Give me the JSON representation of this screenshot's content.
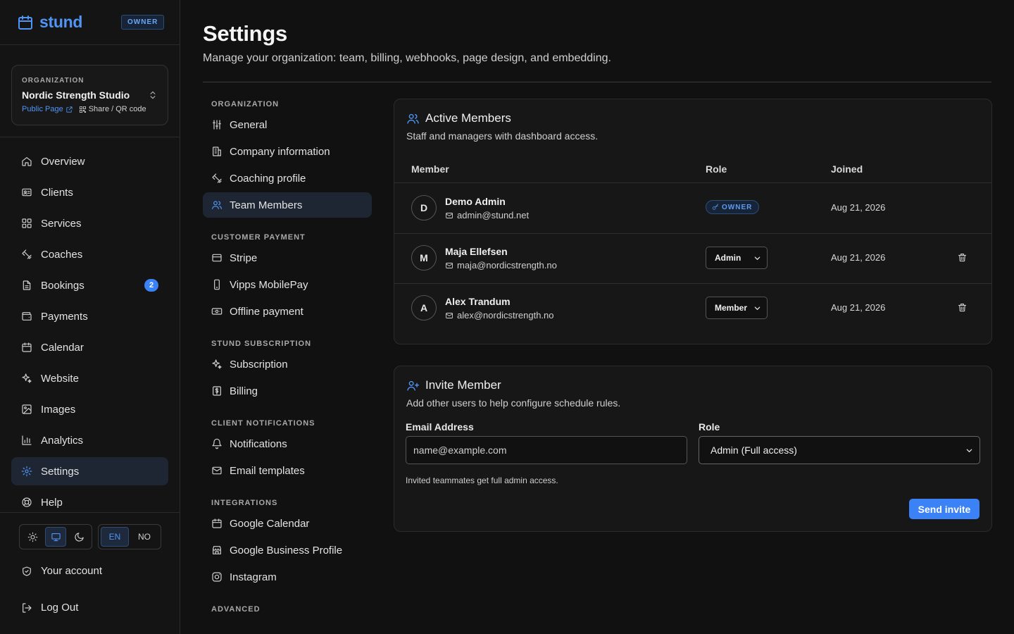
{
  "brand": {
    "name": "stund",
    "role_badge": "OWNER"
  },
  "org": {
    "label": "ORGANIZATION",
    "name": "Nordic Strength Studio",
    "public_page": "Public Page",
    "share": "Share / QR code"
  },
  "nav": {
    "items": [
      {
        "label": "Overview",
        "icon": "home-icon"
      },
      {
        "label": "Clients",
        "icon": "id-card-icon"
      },
      {
        "label": "Services",
        "icon": "grid-icon"
      },
      {
        "label": "Coaches",
        "icon": "dumbbell-icon"
      },
      {
        "label": "Bookings",
        "icon": "document-icon",
        "count": "2"
      },
      {
        "label": "Payments",
        "icon": "wallet-icon"
      },
      {
        "label": "Calendar",
        "icon": "calendar-icon"
      },
      {
        "label": "Website",
        "icon": "sparkles-icon"
      },
      {
        "label": "Images",
        "icon": "image-icon"
      },
      {
        "label": "Analytics",
        "icon": "bar-chart-icon"
      },
      {
        "label": "Settings",
        "icon": "gear-icon",
        "active": true
      },
      {
        "label": "Help",
        "icon": "lifebuoy-icon"
      }
    ]
  },
  "footer": {
    "themes": [
      "light",
      "system",
      "dark"
    ],
    "active_theme": "system",
    "languages": {
      "en": "EN",
      "no": "NO"
    },
    "active_language": "EN",
    "account": "Your account",
    "logout": "Log Out"
  },
  "page": {
    "title": "Settings",
    "subtitle": "Manage your organization: team, billing, webhooks, page design, and embedding."
  },
  "settings_nav": {
    "org_heading": "ORGANIZATION",
    "org_items": [
      "General",
      "Company information",
      "Coaching profile",
      "Team Members"
    ],
    "pay_heading": "CUSTOMER PAYMENT",
    "pay_items": [
      "Stripe",
      "Vipps MobilePay",
      "Offline payment"
    ],
    "sub_heading": "STUND SUBSCRIPTION",
    "sub_items": [
      "Subscription",
      "Billing"
    ],
    "notif_heading": "CLIENT NOTIFICATIONS",
    "notif_items": [
      "Notifications",
      "Email templates"
    ],
    "int_heading": "INTEGRATIONS",
    "int_items": [
      "Google Calendar",
      "Google Business Profile",
      "Instagram"
    ],
    "adv_heading": "ADVANCED",
    "active": "Team Members"
  },
  "members": {
    "title": "Active Members",
    "desc": "Staff and managers with dashboard access.",
    "headers": {
      "member": "Member",
      "role": "Role",
      "joined": "Joined"
    },
    "rows": [
      {
        "initial": "D",
        "name": "Demo Admin",
        "email": "admin@stund.net",
        "role": "OWNER",
        "joined": "Aug 21, 2026"
      },
      {
        "initial": "M",
        "name": "Maja Ellefsen",
        "email": "maja@nordicstrength.no",
        "role": "Admin",
        "joined": "Aug 21, 2026"
      },
      {
        "initial": "A",
        "name": "Alex Trandum",
        "email": "alex@nordicstrength.no",
        "role": "Member",
        "joined": "Aug 21, 2026"
      }
    ]
  },
  "invite": {
    "title": "Invite Member",
    "desc": "Add other users to help configure schedule rules.",
    "email_label": "Email Address",
    "email_placeholder": "name@example.com",
    "email_value": "",
    "role_label": "Role",
    "role_value": "Admin (Full access)",
    "hint": "Invited teammates get full admin access.",
    "send": "Send invite"
  },
  "colors": {
    "accent": "#3b82f6",
    "accent_text": "#4f95f5",
    "background": "#111111",
    "surface": "#171717"
  }
}
